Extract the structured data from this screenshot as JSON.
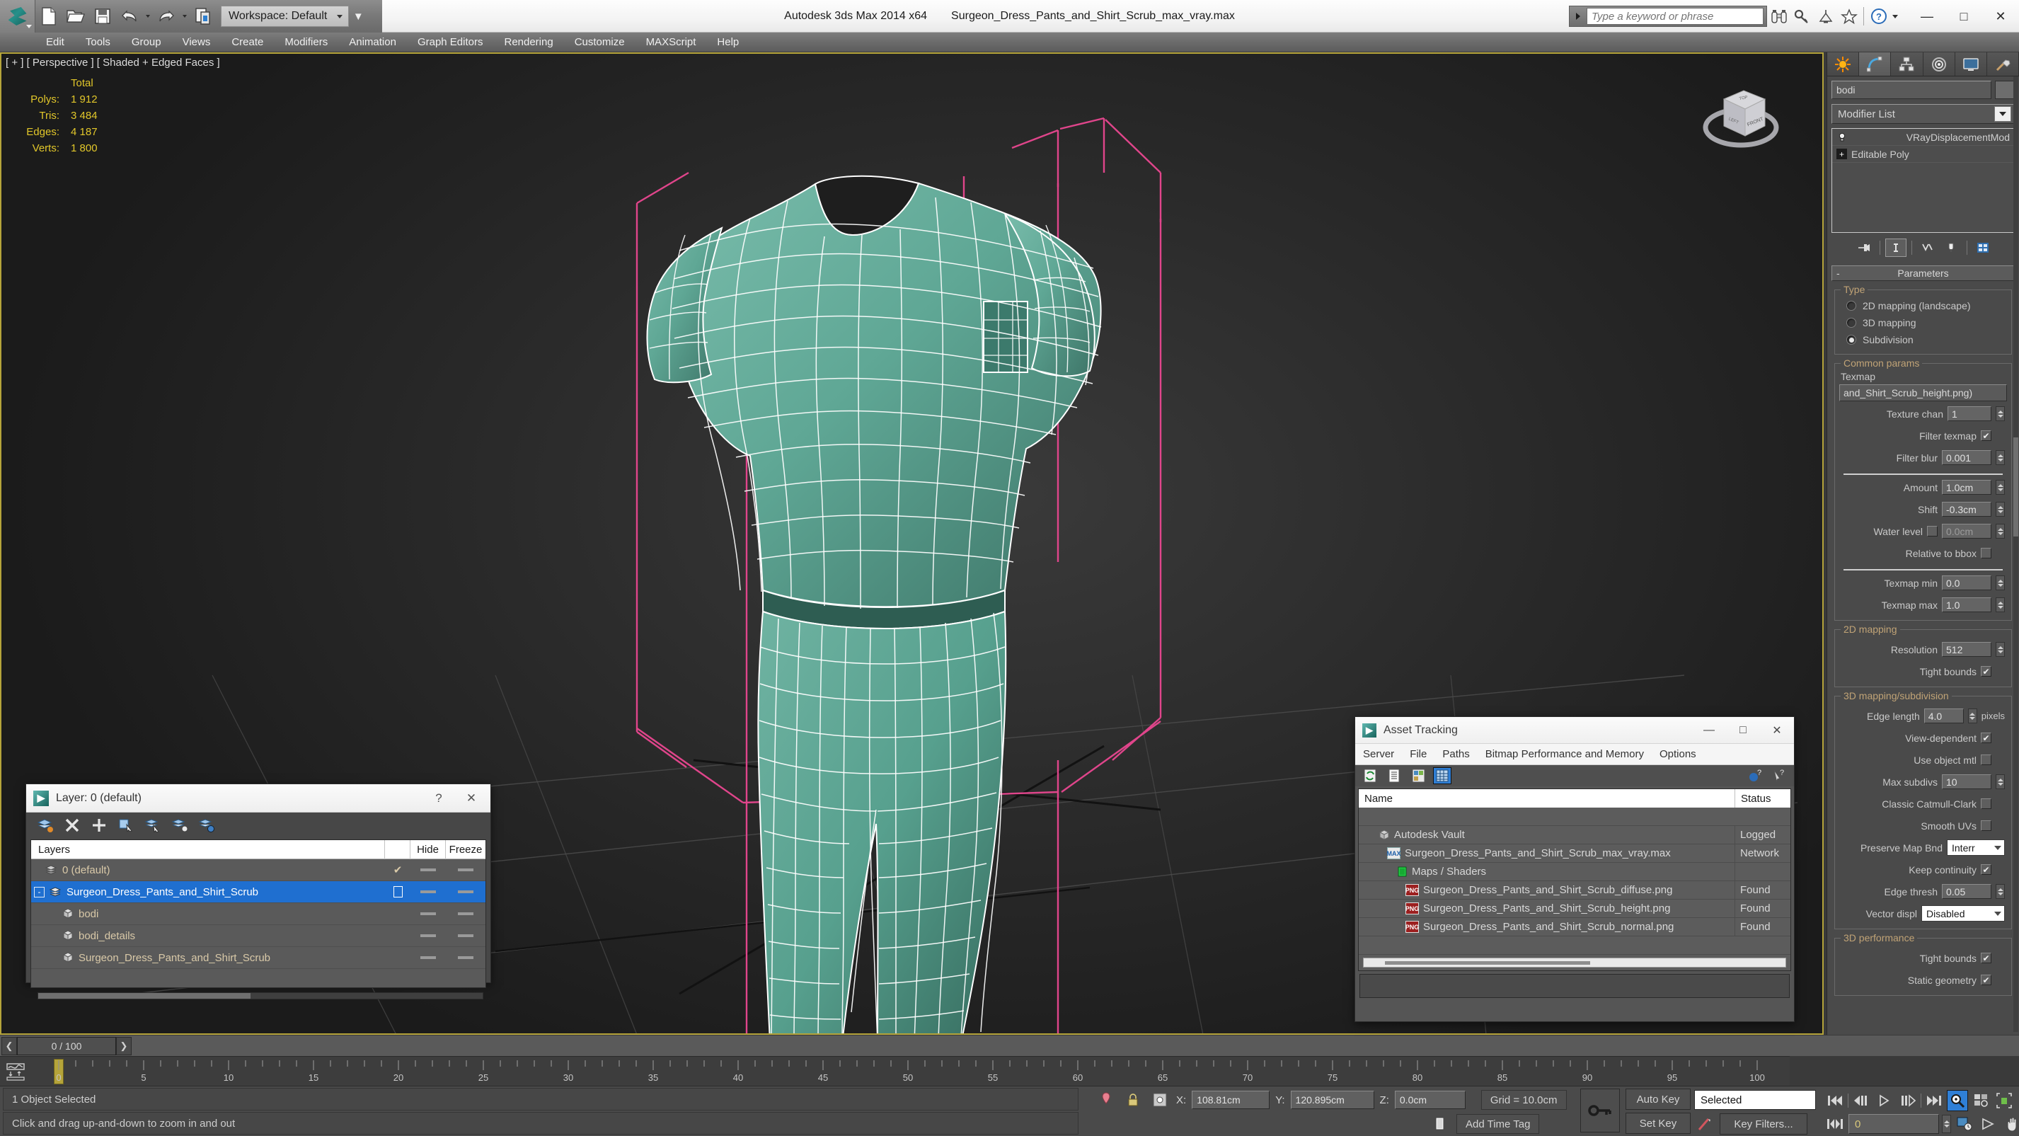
{
  "titlebar": {
    "app_title": "Autodesk 3ds Max  2014 x64",
    "file_name": "Surgeon_Dress_Pants_and_Shirt_Scrub_max_vray.max",
    "workspace_label": "Workspace: Default",
    "search_placeholder": "Type a keyword or phrase",
    "qat_icons": [
      "new-file-icon",
      "open-file-icon",
      "save-file-icon",
      "undo-icon",
      "redo-icon",
      "clone-icon"
    ],
    "right_icons": [
      "binoculars-icon",
      "key-icon",
      "satellite-dish-icon",
      "star-icon",
      "help-icon"
    ],
    "window_controls": [
      "minimize",
      "maximize",
      "close"
    ]
  },
  "menubar": {
    "items": [
      "Edit",
      "Tools",
      "Group",
      "Views",
      "Create",
      "Modifiers",
      "Animation",
      "Graph Editors",
      "Rendering",
      "Customize",
      "MAXScript",
      "Help"
    ]
  },
  "viewport": {
    "label": "[ + ] [ Perspective ] [ Shaded + Edged Faces ]",
    "stats_header": "Total",
    "stats": [
      {
        "label": "Polys:",
        "value": "1 912"
      },
      {
        "label": "Tris:",
        "value": "3 484"
      },
      {
        "label": "Edges:",
        "value": "4 187"
      },
      {
        "label": "Verts:",
        "value": "1 800"
      }
    ],
    "viewcube_faces": [
      "TOP",
      "LEFT",
      "FRONT"
    ],
    "model_color": "#5fa795",
    "wire_color": "#ffffff",
    "selection_color": "#e0458b",
    "background_color": "#2c2c2c"
  },
  "command_panel": {
    "tabs": [
      "create-tab",
      "modify-tab",
      "hierarchy-tab",
      "motion-tab",
      "display-tab",
      "utilities-tab"
    ],
    "active_tab_index": 1,
    "object_name": "bodi",
    "modifier_list_label": "Modifier List",
    "stack": [
      {
        "label": "VRayDisplacementMod",
        "icon": "lightbulb-icon"
      },
      {
        "label": "Editable Poly",
        "icon": "plus-box-icon"
      }
    ],
    "stack_tools": [
      "pin-stack-icon",
      "show-end-result-icon",
      "make-unique-icon",
      "remove-modifier-icon",
      "configure-sets-icon"
    ],
    "rollout_title": "Parameters",
    "type_group": {
      "title": "Type",
      "options": [
        "2D mapping (landscape)",
        "3D mapping",
        "Subdivision"
      ],
      "selected_index": 2
    },
    "common_params": {
      "title": "Common params",
      "texmap_label": "Texmap",
      "texmap_value": "and_Shirt_Scrub_height.png)",
      "rows": [
        {
          "label": "Texture chan",
          "value": "1",
          "type": "spinner"
        },
        {
          "label": "Filter texmap",
          "value": "",
          "type": "checkbox",
          "checked": true
        },
        {
          "label": "Filter blur",
          "value": "0.001",
          "type": "spinner"
        },
        {
          "label": "Amount",
          "value": "1.0cm",
          "type": "spinner"
        },
        {
          "label": "Shift",
          "value": "-0.3cm",
          "type": "spinner"
        },
        {
          "label": "Water level",
          "value": "0.0cm",
          "type": "spinner-check",
          "checked": false
        },
        {
          "label": "Relative to bbox",
          "value": "",
          "type": "checkbox",
          "checked": false
        },
        {
          "label": "Texmap min",
          "value": "0.0",
          "type": "spinner"
        },
        {
          "label": "Texmap max",
          "value": "1.0",
          "type": "spinner"
        }
      ]
    },
    "mapping_2d": {
      "title": "2D mapping",
      "rows": [
        {
          "label": "Resolution",
          "value": "512",
          "type": "spinner"
        },
        {
          "label": "Tight bounds",
          "value": "",
          "type": "checkbox",
          "checked": true
        }
      ]
    },
    "mapping_3d": {
      "title": "3D mapping/subdivision",
      "rows": [
        {
          "label": "Edge length",
          "value": "4.0",
          "suffix": "pixels",
          "type": "spinner"
        },
        {
          "label": "View-dependent",
          "value": "",
          "type": "checkbox",
          "checked": true
        },
        {
          "label": "Use object mtl",
          "value": "",
          "type": "checkbox",
          "checked": false
        },
        {
          "label": "Max subdivs",
          "value": "10",
          "type": "spinner"
        },
        {
          "label": "Classic Catmull-Clark",
          "value": "",
          "type": "checkbox",
          "checked": false
        },
        {
          "label": "Smooth UVs",
          "value": "",
          "type": "checkbox",
          "checked": false
        },
        {
          "label": "Preserve Map Bnd",
          "value": "Interr",
          "type": "select"
        },
        {
          "label": "Keep continuity",
          "value": "",
          "type": "checkbox",
          "checked": true
        },
        {
          "label": "Edge thresh",
          "value": "0.05",
          "type": "spinner"
        },
        {
          "label": "Vector displ",
          "value": "Disabled",
          "type": "select"
        }
      ]
    },
    "performance_3d": {
      "title": "3D performance",
      "rows": [
        {
          "label": "Tight bounds",
          "value": "",
          "type": "checkbox",
          "checked": true
        },
        {
          "label": "Static geometry",
          "value": "",
          "type": "checkbox",
          "checked": true
        }
      ]
    }
  },
  "layer_dialog": {
    "title": "Layer: 0 (default)",
    "help_btn": "?",
    "close_btn": "✕",
    "toolbar_icons": [
      "create-new-layer-icon",
      "delete-layer-icon",
      "add-selection-icon",
      "select-objects-icon",
      "select-highlighted-icon",
      "highlight-selected-icon",
      "layer-properties-icon"
    ],
    "columns": [
      "Layers",
      "Hide",
      "Freeze"
    ],
    "rows": [
      {
        "name": "0 (default)",
        "indent": 0,
        "icon": "layer-icon",
        "current": true,
        "selected": false,
        "expander": ""
      },
      {
        "name": "Surgeon_Dress_Pants_and_Shirt_Scrub",
        "indent": 0,
        "icon": "layer-icon",
        "current": false,
        "selected": true,
        "expander": "-"
      },
      {
        "name": "bodi",
        "indent": 1,
        "icon": "object-icon",
        "current": false,
        "selected": false,
        "expander": ""
      },
      {
        "name": "bodi_details",
        "indent": 1,
        "icon": "object-icon",
        "current": false,
        "selected": false,
        "expander": ""
      },
      {
        "name": "Surgeon_Dress_Pants_and_Shirt_Scrub",
        "indent": 1,
        "icon": "object-icon",
        "current": false,
        "selected": false,
        "expander": ""
      }
    ]
  },
  "asset_tracking": {
    "title": "Asset Tracking",
    "menu": [
      "Server",
      "File",
      "Paths",
      "Bitmap Performance and Memory",
      "Options"
    ],
    "toolbar_icons": [
      "refresh-icon",
      "list-view-icon",
      "detail-view-icon",
      "grid-view-icon"
    ],
    "toolbar_right_icons": [
      "add-help-icon",
      "help-cursor-icon"
    ],
    "columns": [
      "Name",
      "Status"
    ],
    "rows": [
      {
        "name": "Autodesk Vault",
        "status": "Logged",
        "indent": 0,
        "icon": "vault-icon"
      },
      {
        "name": "Surgeon_Dress_Pants_and_Shirt_Scrub_max_vray.max",
        "status": "Network",
        "indent": 1,
        "icon": "max-file-icon"
      },
      {
        "name": "Maps / Shaders",
        "status": "",
        "indent": 2,
        "icon": "maps-icon"
      },
      {
        "name": "Surgeon_Dress_Pants_and_Shirt_Scrub_diffuse.png",
        "status": "Found",
        "indent": 3,
        "icon": "png-file-icon"
      },
      {
        "name": "Surgeon_Dress_Pants_and_Shirt_Scrub_height.png",
        "status": "Found",
        "indent": 3,
        "icon": "png-file-icon"
      },
      {
        "name": "Surgeon_Dress_Pants_and_Shirt_Scrub_normal.png",
        "status": "Found",
        "indent": 3,
        "icon": "png-file-icon"
      }
    ]
  },
  "timeline": {
    "frame_display": "0 / 100",
    "current_frame": 0,
    "ticks": [
      "0",
      "5",
      "10",
      "15",
      "20",
      "25",
      "30",
      "35",
      "40",
      "45",
      "50",
      "55",
      "60",
      "65",
      "70",
      "75",
      "80",
      "85",
      "90",
      "95",
      "100"
    ]
  },
  "statusbar": {
    "selection_text": "1 Object Selected",
    "prompt_text": "Click and drag up-and-down to zoom in and out",
    "coord_x_label": "X:",
    "coord_x": "108.81cm",
    "coord_y_label": "Y:",
    "coord_y": "120.895cm",
    "coord_z_label": "Z:",
    "coord_z": "0.0cm",
    "grid_text": "Grid = 10.0cm",
    "add_time_tag": "Add Time Tag",
    "auto_key": "Auto Key",
    "set_key": "Set Key",
    "key_filters": "Key Filters...",
    "selection_set": "Selected",
    "key_frame_value": "0",
    "nav_icons": [
      "zoom-icon",
      "zoom-all-icon",
      "zoom-extents-icon",
      "zoom-extents-all-icon",
      "field-of-view-icon",
      "pan-icon",
      "orbit-icon",
      "maximize-viewport-icon"
    ],
    "playback_icons": [
      "go-to-start-icon",
      "previous-frame-icon",
      "play-icon",
      "next-frame-icon",
      "go-to-end-icon",
      "key-mode-icon"
    ]
  }
}
